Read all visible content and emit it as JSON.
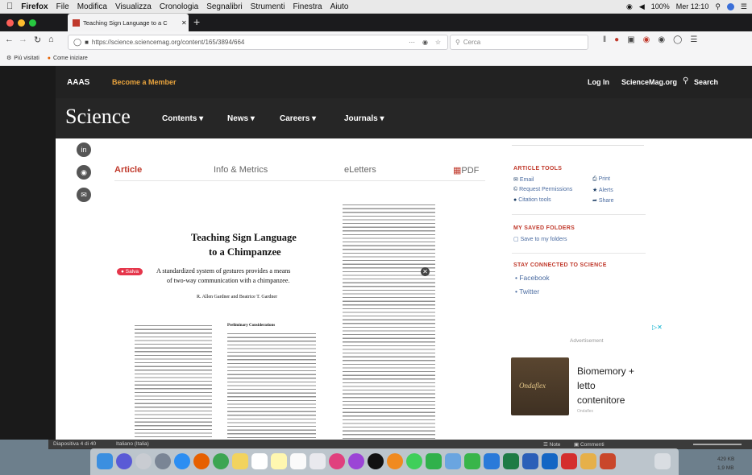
{
  "menubar": {
    "apple": "",
    "items": [
      "Firefox",
      "File",
      "Modifica",
      "Visualizza",
      "Cronologia",
      "Segnalibri",
      "Strumenti",
      "Finestra",
      "Aiuto"
    ],
    "battery": "100%",
    "clock": "Mer 12:10"
  },
  "browser": {
    "tab_title": "Teaching Sign Language to a C",
    "url": "https://science.sciencemag.org/content/165/3894/664",
    "url_more": "···",
    "search_placeholder": "Cerca",
    "bookmarks": [
      "Più visitati",
      "Come iniziare"
    ]
  },
  "header": {
    "aaas": "AAAS",
    "become_member": "Become a Member",
    "login": "Log In",
    "sciencemag": "ScienceMag.org",
    "search": "Search",
    "logo": "Science",
    "nav": [
      "Contents",
      "News",
      "Careers",
      "Journals"
    ]
  },
  "article_tabs": [
    "Article",
    "Info & Metrics",
    "eLetters",
    "PDF"
  ],
  "paper": {
    "title_line1": "Teaching Sign Language",
    "title_line2": "to a Chimpanzee",
    "badge": "Salva",
    "abstract": "A standardized system of gestures provides a means",
    "abstract2": "of two-way communication with a chimpanzee.",
    "authors": "R. Allen Gardner and Beatrice T. Gardner",
    "section_heading": "Preliminary Considerations"
  },
  "sidebar": {
    "article_tools_title": "ARTICLE TOOLS",
    "tools": [
      "Email",
      "Print",
      "Request Permissions",
      "Alerts",
      "Citation tools",
      "Share"
    ],
    "saved_folders_title": "MY SAVED FOLDERS",
    "save_to_folders": "Save to my folders",
    "stay_connected_title": "STAY CONNECTED TO SCIENCE",
    "social": [
      "Facebook",
      "Twitter"
    ],
    "advertisement_label": "Advertisement",
    "ad_title_line1": "Biomemory +",
    "ad_title_line2": "letto",
    "ad_title_line3": "contenitore",
    "ad_brand": "Ondaflex"
  },
  "statusbar": {
    "slide": "Diapositiva 4 di 40",
    "language": "Italiano (Italia)",
    "notes": "Note",
    "comments": "Commenti",
    "size1": "429 KB",
    "size2": "1,9 MB"
  },
  "colors": {
    "science_red": "#c0392b",
    "accent_orange": "#e8a33d",
    "header_dark": "#222222"
  }
}
